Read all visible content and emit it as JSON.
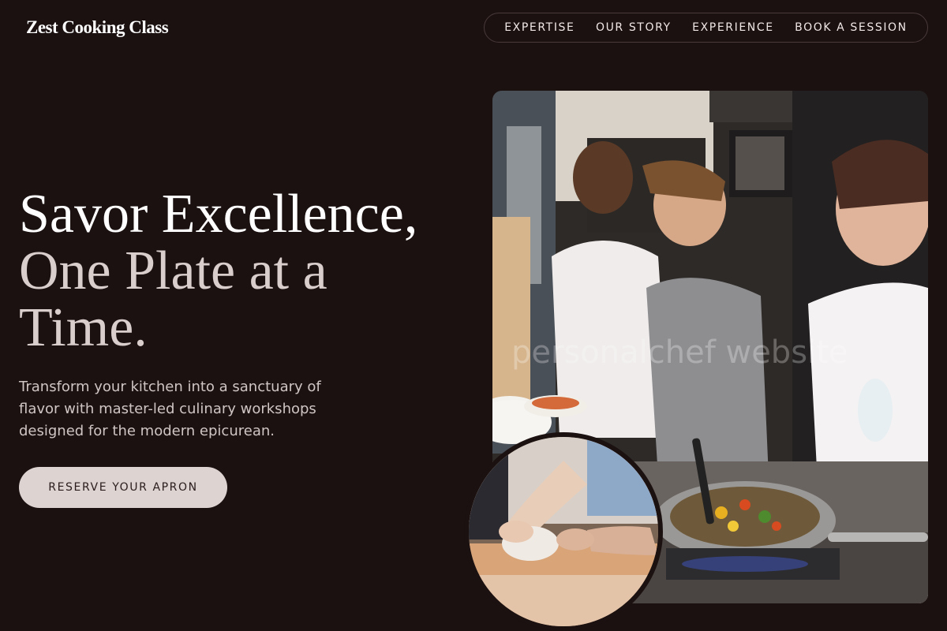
{
  "header": {
    "logo": "Zest Cooking Class",
    "nav": [
      {
        "label": "EXPERTISE"
      },
      {
        "label": "OUR STORY"
      },
      {
        "label": "EXPERIENCE"
      },
      {
        "label": "BOOK A SESSION"
      }
    ]
  },
  "hero": {
    "headline_line1": "Savor Excellence,",
    "headline_line2": "One Plate at a Time.",
    "subtext": "Transform your kitchen into a sanctuary of flavor with master-led culinary workshops designed for the modern epicurean.",
    "cta_label": "RESERVE YOUR APRON"
  },
  "media": {
    "watermark": "personalchef website"
  },
  "colors": {
    "background": "#1b1111",
    "cta_bg": "#ddd3d1",
    "headline_secondary": "#d9cecc"
  }
}
